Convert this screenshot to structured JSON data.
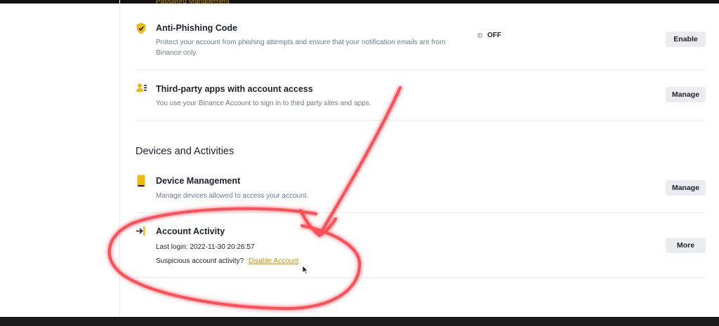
{
  "top_cut_link": "Password Management",
  "anti_phishing": {
    "title": "Anti-Phishing Code",
    "desc_line1": "Protect your account from phishing attempts and ensure that your notification emails are from",
    "desc_line2": "Binance only.",
    "status": "OFF",
    "button": "Enable"
  },
  "third_party": {
    "title": "Third-party apps with account access",
    "desc": "You use your Binance Account to sign in to third party sites and apps.",
    "button": "Manage"
  },
  "section_heading": "Devices and Activities",
  "device_management": {
    "title": "Device Management",
    "desc": "Manage devices allowed to access your account.",
    "button": "Manage"
  },
  "account_activity": {
    "title": "Account Activity",
    "last_login": "Last login: 2022-11-30 20:26:57",
    "suspicious_prefix": "Suspicious account activity?",
    "disable_link": "Disable Account",
    "button": "More"
  },
  "colors": {
    "accent_gold": "#c99400",
    "icon_yellow": "#f0b90b",
    "annotation_red": "#ff3b44"
  }
}
